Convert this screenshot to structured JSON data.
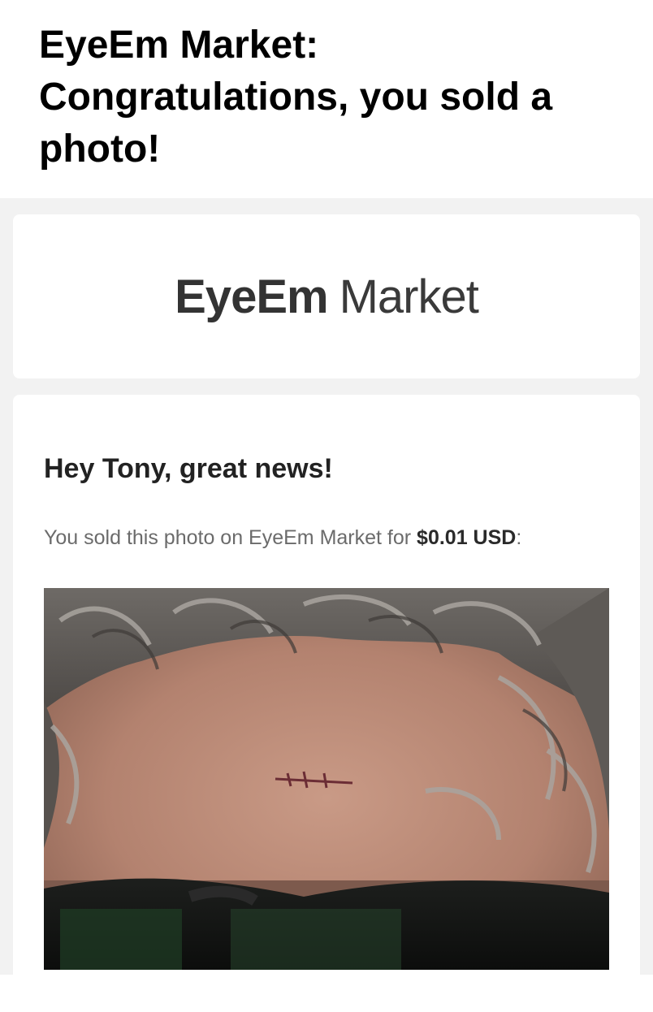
{
  "email": {
    "subject": "EyeEm Market: Congratulations, you sold a photo!"
  },
  "logo": {
    "brand": "EyeEm",
    "product": "Market"
  },
  "body": {
    "greeting": "Hey Tony, great news!",
    "sold_prefix": "You sold this photo on EyeEm Market for ",
    "price": "$0.01 USD",
    "sold_suffix": ":"
  },
  "photo": {
    "description_icon": "photo-thumbnail"
  }
}
